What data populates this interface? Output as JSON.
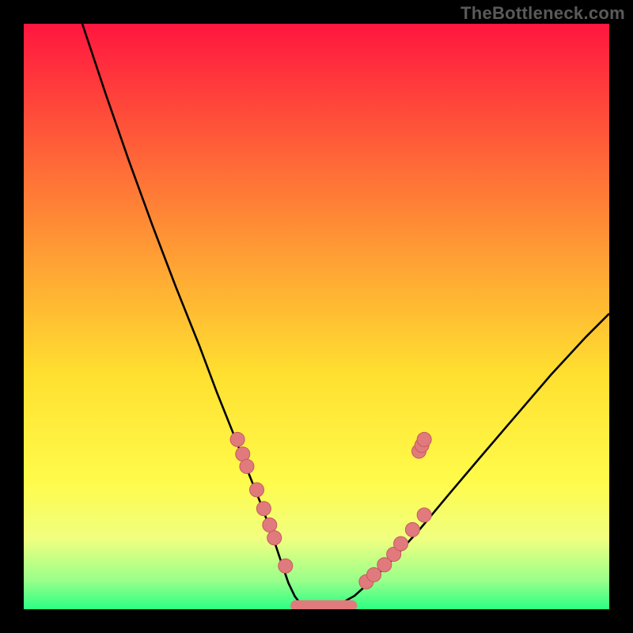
{
  "watermark": "TheBottleneck.com",
  "chart_data": {
    "type": "line",
    "title": "",
    "xlabel": "",
    "ylabel": "",
    "xlim": [
      0,
      100
    ],
    "ylim": [
      0,
      100
    ],
    "series": [
      {
        "name": "curve",
        "x": [
          10,
          14,
          18,
          22,
          26,
          30,
          33,
          36,
          38.5,
          40.7,
          42.5,
          44,
          45.2,
          46.3,
          47.3,
          48.5,
          50,
          52,
          54,
          56.5,
          59.5,
          63,
          67.5,
          72.5,
          78,
          84,
          90,
          96,
          100
        ],
        "y": [
          100,
          88,
          76.5,
          65.5,
          55,
          45,
          37,
          29.5,
          23,
          17.5,
          12.5,
          8,
          4.5,
          2.2,
          0.9,
          0.2,
          0,
          0.2,
          0.9,
          2.3,
          5,
          8.5,
          13.5,
          19.5,
          26,
          33,
          40,
          46.5,
          50.5
        ]
      }
    ],
    "scatter": {
      "name": "markers",
      "points": [
        [
          36.5,
          29.0
        ],
        [
          37.4,
          26.5
        ],
        [
          38.1,
          24.4
        ],
        [
          39.8,
          20.4
        ],
        [
          41.0,
          17.2
        ],
        [
          42.0,
          14.4
        ],
        [
          42.8,
          12.2
        ],
        [
          44.7,
          7.4
        ],
        [
          58.5,
          4.7
        ],
        [
          59.8,
          5.9
        ],
        [
          61.6,
          7.6
        ],
        [
          63.2,
          9.4
        ],
        [
          64.4,
          11.2
        ],
        [
          66.4,
          13.6
        ],
        [
          68.4,
          16.1
        ],
        [
          67.5,
          27.0
        ],
        [
          68.0,
          28.0
        ],
        [
          68.4,
          29.0
        ]
      ]
    },
    "bottom_band": {
      "name": "flat-bottom",
      "x": [
        46.5,
        56.0
      ],
      "y": [
        0.6,
        0.6
      ]
    },
    "colors": {
      "curve_stroke": "#000000",
      "marker_fill": "#e07a7d",
      "marker_stroke": "#c55a5d"
    }
  }
}
